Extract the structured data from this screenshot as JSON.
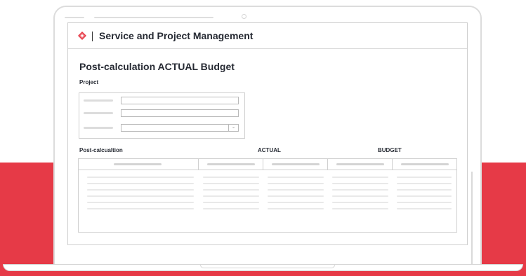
{
  "app": {
    "title": "Service and Project Management",
    "logo": "diamond-logo"
  },
  "page": {
    "title": "Post-calculation ACTUAL Budget"
  },
  "project_section": {
    "label": "Project",
    "fields": [
      {
        "type": "text",
        "value": ""
      },
      {
        "type": "text",
        "value": ""
      },
      {
        "type": "select",
        "value": "",
        "icon": "chevron-down-icon"
      }
    ]
  },
  "table_section": {
    "label": "Post-calcualtion",
    "actual_label": "ACTUAL",
    "budget_label": "BUDGET",
    "column_count": 5,
    "row_count": 6
  },
  "colors": {
    "accent": "#e63a47",
    "text": "#262a33",
    "border": "#cfcfcf"
  }
}
